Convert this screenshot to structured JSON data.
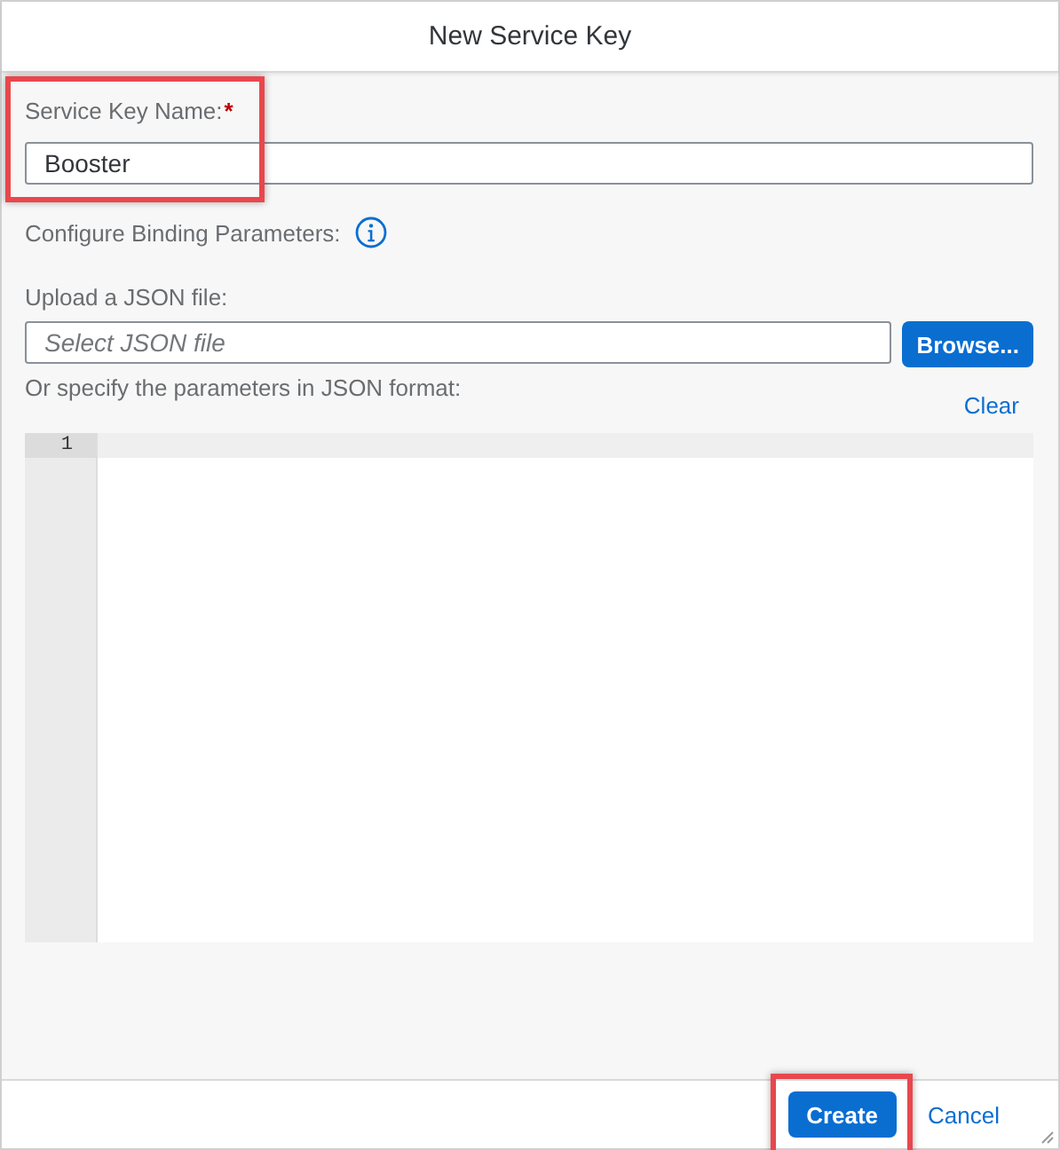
{
  "window": {
    "title": "New Service Key"
  },
  "name_field": {
    "label": "Service Key Name:",
    "required_mark": "*",
    "value": "Booster",
    "highlighted": true
  },
  "binding": {
    "label": "Configure Binding Parameters:"
  },
  "upload": {
    "label": "Upload a JSON file:",
    "placeholder": "Select JSON file",
    "button": "Browse..."
  },
  "editor": {
    "label": "Or specify the parameters in JSON format:",
    "clear": "Clear",
    "line_numbers": [
      "1"
    ]
  },
  "footer": {
    "buttons": [
      {
        "label": "Create",
        "kind": "primary",
        "highlighted": true
      },
      {
        "label": "Cancel",
        "kind": "link",
        "highlighted": false
      }
    ]
  }
}
